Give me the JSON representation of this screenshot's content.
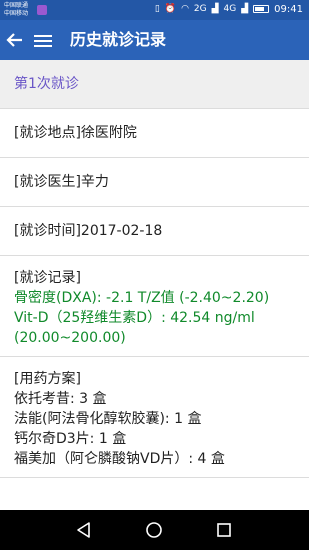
{
  "status_bar": {
    "carrier1": "中国联通",
    "carrier2": "中国移动",
    "network1": "2G",
    "network2": "4G",
    "time": "09:41"
  },
  "app_bar": {
    "title": "历史就诊记录"
  },
  "visit": {
    "header": "第1次就诊",
    "location": "[就诊地点]徐医附院",
    "doctor": "[就诊医生]辛力",
    "time": "[就诊时间]2017-02-18",
    "record_label": "[就诊记录]",
    "record_line1": "骨密度(DXA): -2.1 T/Z值 (-2.40~2.20)",
    "record_line2": "Vit-D（25羟维生素D）: 42.54 ng/ml",
    "record_line3": "(20.00~200.00)",
    "medication_label": "[用药方案]",
    "med1": "依托考昔: 3 盒",
    "med2": "法能(阿法骨化醇软胶囊): 1 盒",
    "med3": "钙尔奇D3片: 1 盒",
    "med4": "福美加（阿仑膦酸钠VD片）: 4 盒"
  },
  "colors": {
    "app_bar": "#2b63b8",
    "status_bar": "#2357a6",
    "section_header_text": "#6a56c7",
    "record_text": "#118a2b"
  }
}
